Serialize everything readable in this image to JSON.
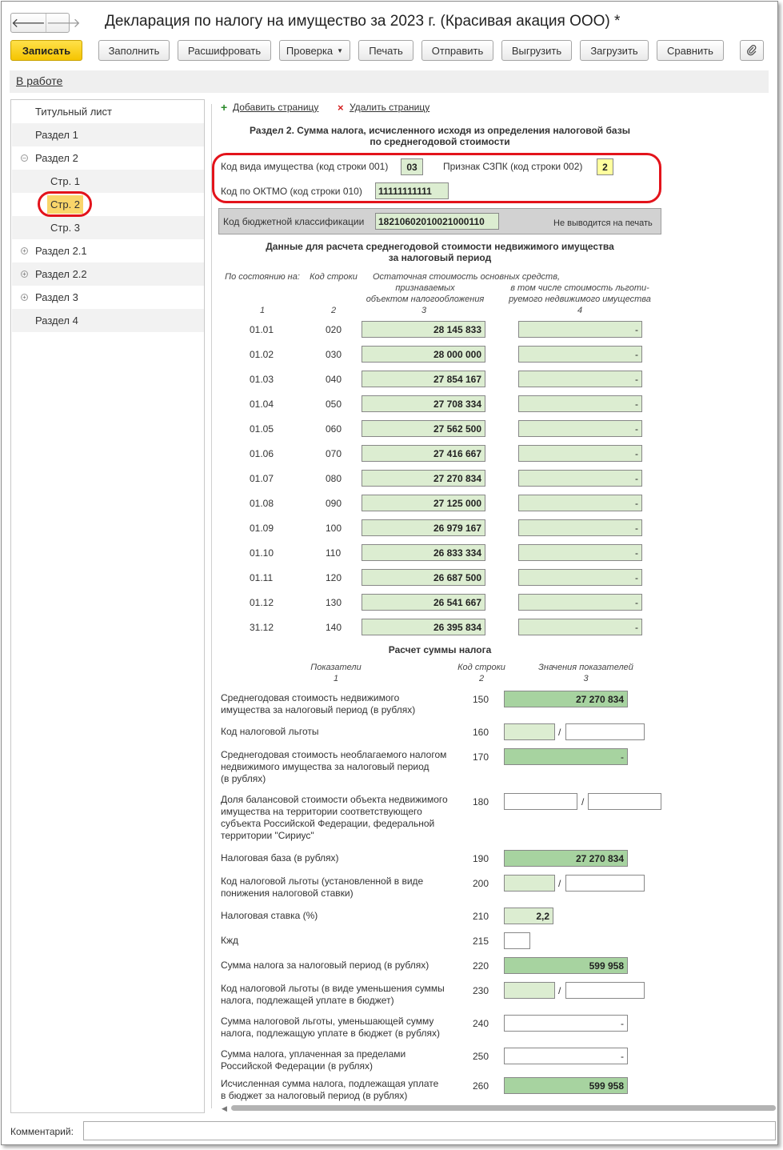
{
  "window": {
    "title": "Декларация по налогу на имущество за 2023 г. (Красивая акация ООО) *",
    "nav_back": "🡐",
    "nav_forward": "🡒"
  },
  "toolbar": {
    "save": "Записать",
    "fill": "Заполнить",
    "decode": "Расшифровать",
    "check": "Проверка",
    "print": "Печать",
    "send": "Отправить",
    "export": "Выгрузить",
    "import": "Загрузить",
    "compare": "Сравнить",
    "attach_icon": "paperclip-icon"
  },
  "status": {
    "link": "В работе"
  },
  "tree": {
    "items": [
      {
        "label": "Титульный лист"
      },
      {
        "label": "Раздел 1"
      },
      {
        "label": "Раздел 2",
        "toggle": "⊖"
      },
      {
        "label": "Стр. 1"
      },
      {
        "label": "Стр. 2"
      },
      {
        "label": "Стр. 3"
      },
      {
        "label": "Раздел 2.1",
        "toggle": "⊕"
      },
      {
        "label": "Раздел 2.2",
        "toggle": "⊕"
      },
      {
        "label": "Раздел 3",
        "toggle": "⊕"
      },
      {
        "label": "Раздел 4"
      }
    ]
  },
  "page_actions": {
    "add_icon": "+",
    "add": "Добавить страницу",
    "delete_icon": "×",
    "delete": "Удалить страницу"
  },
  "section": {
    "title_line1": "Раздел 2. Сумма налога, исчисленного исходя из определения налоговой базы",
    "title_line2": "по среднегодовой стоимости",
    "property_code_label": "Код вида имущества (код строки 001)",
    "property_code": "03",
    "szpk_label": "Признак СЗПК (код строки 002)",
    "szpk": "2",
    "oktmo_label": "Код по ОКТМО (код строки 010)",
    "oktmo": "11111111111",
    "kbk_label": "Код бюджетной классификации",
    "kbk": "18210602010021000110",
    "no_print": "Не выводится на печать"
  },
  "avg_table": {
    "title_line1": "Данные для расчета среднегодовой стоимости недвижимого имущества",
    "title_line2": "за налоговый период",
    "col1": "По состоянию на:",
    "col2": "Код строки",
    "col3_line1": "Остаточная стоимость основных средств,",
    "col3_line2": "признаваемых",
    "col3_line3": "объектом налогообложения",
    "col4_line1": "в том числе стоимость льготи-",
    "col4_line2": "руемого недвижимого имущества",
    "n1": "1",
    "n2": "2",
    "n3": "3",
    "n4": "4",
    "rows": [
      {
        "date": "01.01",
        "code": "020",
        "value": "28 145 833",
        "lgot": "-"
      },
      {
        "date": "01.02",
        "code": "030",
        "value": "28 000 000",
        "lgot": "-"
      },
      {
        "date": "01.03",
        "code": "040",
        "value": "27 854 167",
        "lgot": "-"
      },
      {
        "date": "01.04",
        "code": "050",
        "value": "27 708 334",
        "lgot": "-"
      },
      {
        "date": "01.05",
        "code": "060",
        "value": "27 562 500",
        "lgot": "-"
      },
      {
        "date": "01.06",
        "code": "070",
        "value": "27 416 667",
        "lgot": "-"
      },
      {
        "date": "01.07",
        "code": "080",
        "value": "27 270 834",
        "lgot": "-"
      },
      {
        "date": "01.08",
        "code": "090",
        "value": "27 125 000",
        "lgot": "-"
      },
      {
        "date": "01.09",
        "code": "100",
        "value": "26 979 167",
        "lgot": "-"
      },
      {
        "date": "01.10",
        "code": "110",
        "value": "26 833 334",
        "lgot": "-"
      },
      {
        "date": "01.11",
        "code": "120",
        "value": "26 687 500",
        "lgot": "-"
      },
      {
        "date": "01.12",
        "code": "130",
        "value": "26 541 667",
        "lgot": "-"
      },
      {
        "date": "31.12",
        "code": "140",
        "value": "26 395 834",
        "lgot": "-"
      }
    ]
  },
  "calc": {
    "title": "Расчет суммы налога",
    "col1": "Показатели",
    "col2": "Код строки",
    "col3": "Значения показателей",
    "n1": "1",
    "n2": "2",
    "n3": "3",
    "slash": "/",
    "rows": {
      "r150": {
        "label1": "Среднегодовая стоимость недвижимого",
        "label2": "имущества за налоговый период (в рублях)",
        "code": "150",
        "value": "27 270 834"
      },
      "r160": {
        "label1": "Код налоговой льготы",
        "code": "160"
      },
      "r170": {
        "label1": "Среднегодовая стоимость необлагаемого налогом",
        "label2": "недвижимого имущества за налоговый период",
        "label3": "(в рублях)",
        "code": "170",
        "value": "-"
      },
      "r180": {
        "label1": "Доля балансовой стоимости объекта недвижимого",
        "label2": "имущества на территории соответствующего",
        "label3": "субъекта Российской Федерации, федеральной",
        "label4": "территории \"Сириус\"",
        "code": "180"
      },
      "r190": {
        "label1": "Налоговая база (в рублях)",
        "code": "190",
        "value": "27 270 834"
      },
      "r200": {
        "label1": "Код налоговой льготы (установленной в виде",
        "label2": "понижения налоговой ставки)",
        "code": "200"
      },
      "r210": {
        "label1": "Налоговая ставка (%)",
        "code": "210",
        "value": "2,2"
      },
      "r215": {
        "label1": "Кжд",
        "code": "215"
      },
      "r220": {
        "label1": "Сумма налога за налоговый период (в рублях)",
        "code": "220",
        "value": "599 958"
      },
      "r230": {
        "label1": "Код налоговой льготы (в виде уменьшения суммы",
        "label2": "налога, подлежащей уплате в бюджет)",
        "code": "230"
      },
      "r240": {
        "label1": "Сумма налоговой льготы, уменьшающей сумму",
        "label2": "налога, подлежащую уплате в бюджет (в рублях)",
        "code": "240",
        "value": "-"
      },
      "r250": {
        "label1": "Сумма налога, уплаченная за пределами",
        "label2": "Российской Федерации (в рублях)",
        "code": "250",
        "value": "-"
      },
      "r260": {
        "label1": "Исчисленная сумма налога, подлежащая уплате",
        "label2": "в бюджет за налоговый период (в рублях)",
        "code": "260",
        "value": "599 958"
      }
    }
  },
  "footer": {
    "comment_label": "Комментарий:"
  }
}
